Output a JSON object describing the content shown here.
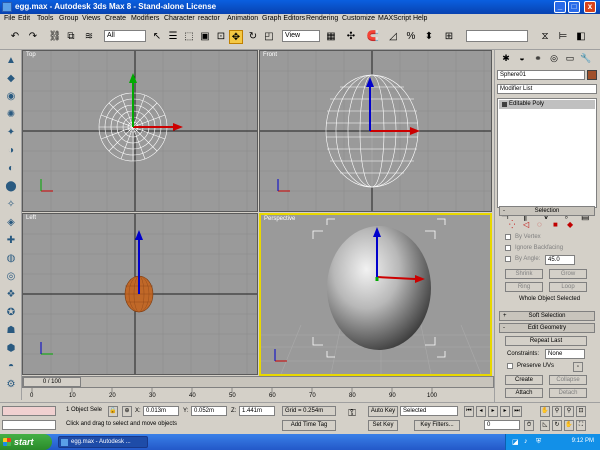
{
  "window": {
    "title": "egg.max - Autodesk 3ds Max 8  - Stand-alone License",
    "minimize": "_",
    "maximize": "□",
    "close": "x"
  },
  "menu": [
    "File",
    "Edit",
    "Tools",
    "Group",
    "Views",
    "Create",
    "Modifiers",
    "Character",
    "reactor",
    "Animation",
    "Graph Editors",
    "Rendering",
    "Customize",
    "MAXScript",
    "Help"
  ],
  "toolbar": {
    "selection_filter": "All",
    "ref_coord": "View"
  },
  "viewports": {
    "top": "Top",
    "front": "Front",
    "left": "Left",
    "perspective": "Perspective"
  },
  "timeline": {
    "slider": "0 / 100",
    "ticks": [
      "0",
      "10",
      "20",
      "30",
      "40",
      "50",
      "60",
      "70",
      "80",
      "90",
      "100"
    ]
  },
  "status": {
    "selection": "1 Object Sele",
    "x_label": "X:",
    "x_value": "0.013m",
    "y_label": "Y:",
    "y_value": "0.052m",
    "z_label": "Z:",
    "z_value": "1.441m",
    "grid": "Grid = 0.254m",
    "prompt": "Click and drag to select and move objects",
    "add_time_tag": "Add Time Tag",
    "auto_key": "Auto Key",
    "set_key": "Set Key",
    "key_mode": "Selected",
    "key_filters": "Key Filters...",
    "frame": "0"
  },
  "command_panel": {
    "object_name": "Sphere01",
    "modifier_list": "Modifier List",
    "stack_item": "Editable Poly",
    "selection_title": "Selection",
    "by_vertex": "By Vertex",
    "ignore_backfacing": "Ignore Backfacing",
    "by_angle": "By Angle:",
    "angle_value": "45.0",
    "shrink": "Shrink",
    "grow": "Grow",
    "ring": "Ring",
    "loop": "Loop",
    "whole_selected": "Whole Object Selected",
    "soft_selection": "Soft Selection",
    "edit_geometry": "Edit Geometry",
    "repeat_last": "Repeat Last",
    "constraints": "Constraints:",
    "constraints_value": "None",
    "preserve_uvs": "Preserve UVs",
    "create": "Create",
    "collapse": "Collapse",
    "attach": "Attach",
    "detach": "Detach"
  },
  "taskbar": {
    "start": "start",
    "task": "egg.max - Autodesk ...",
    "clock": "9:12 PM"
  }
}
